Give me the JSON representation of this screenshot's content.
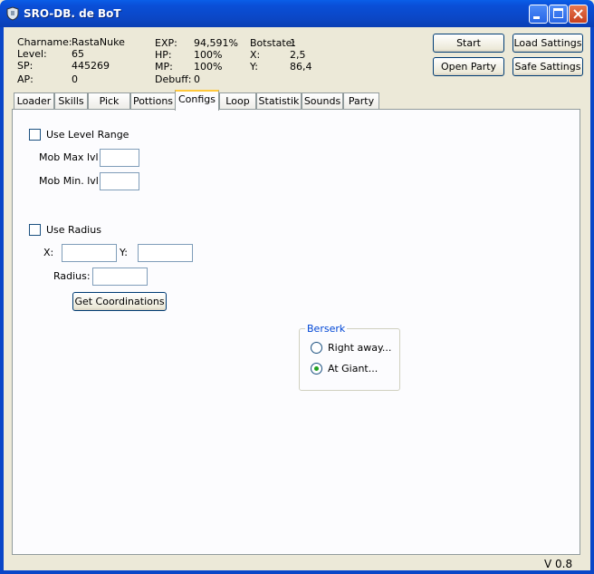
{
  "window": {
    "title": "SRO-DB. de BoT",
    "version": "V 0.8"
  },
  "icons": {
    "app": "shield-icon",
    "minimize": "minimize-icon",
    "maximize": "maximize-icon",
    "close": "close-icon"
  },
  "stats": {
    "charname_label": "Charname:",
    "charname": "RastaNuke",
    "level_label": "Level:",
    "level": "65",
    "sp_label": "SP:",
    "sp": "445269",
    "ap_label": "AP:",
    "ap": "0",
    "exp_label": "EXP:",
    "exp": "94,591%",
    "hp_label": "HP:",
    "hp": "100%",
    "mp_label": "MP:",
    "mp": "100%",
    "debuff_label": "Debuff:",
    "debuff": "0",
    "botstate_label": "Botstate:",
    "botstate": "1",
    "x_label": "X:",
    "x": "2,5",
    "y_label": "Y:",
    "y": "86,4"
  },
  "buttons": {
    "start": "Start",
    "load_settings": "Load Sattings",
    "open_party": "Open Party",
    "safe_settings": "Safe Sattings"
  },
  "tabs": [
    "Loader",
    "Skills",
    "Pick",
    "Pottions",
    "Configs",
    "Loop",
    "Statistik",
    "Sounds",
    "Party"
  ],
  "configs": {
    "use_level_range": "Use Level Range",
    "mob_max_lvl": "Mob Max lvl",
    "mob_max_lvl_value": "",
    "mob_min_lvl": "Mob Min. lvl",
    "mob_min_lvl_value": "",
    "use_radius": "Use Radius",
    "x_label": "X:",
    "x_value": "",
    "y_label": "Y:",
    "y_value": "",
    "radius_label": "Radius:",
    "radius_value": "",
    "get_coordinations": "Get Coordinations",
    "berserk": {
      "label": "Berserk",
      "options": [
        "Right away...",
        "At Giant..."
      ],
      "selected": "At Giant..."
    }
  },
  "colors": {
    "titlebar": "#0a4fd8",
    "active_tab_accent": "#ffc83c",
    "group_label": "#0046d5",
    "radio_dot": "#21a121"
  }
}
